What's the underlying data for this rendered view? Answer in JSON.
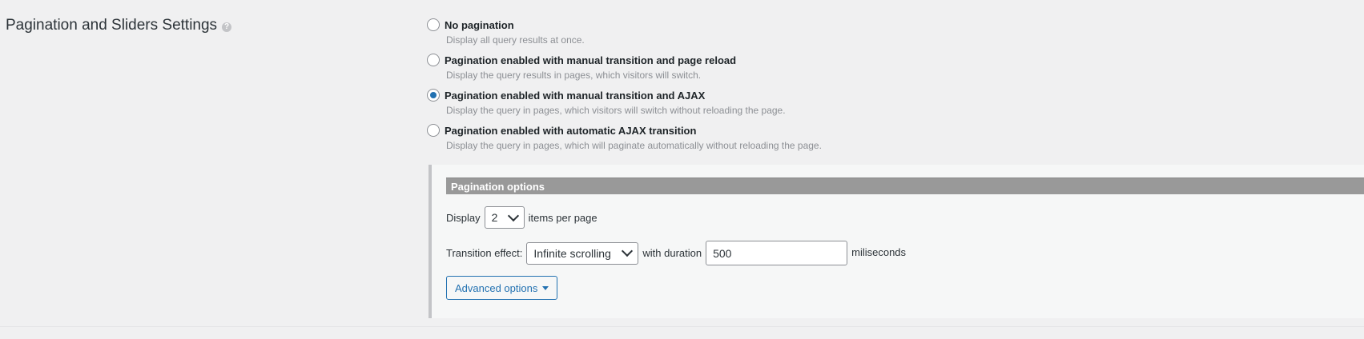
{
  "section": {
    "title": "Pagination and Sliders Settings"
  },
  "pagination_modes": [
    {
      "label": "No pagination",
      "description": "Display all query results at once.",
      "checked": false
    },
    {
      "label": "Pagination enabled with manual transition and page reload",
      "description": "Display the query results in pages, which visitors will switch.",
      "checked": false
    },
    {
      "label": "Pagination enabled with manual transition and AJAX",
      "description": "Display the query in pages, which visitors will switch without reloading the page.",
      "checked": true
    },
    {
      "label": "Pagination enabled with automatic AJAX transition",
      "description": "Display the query in pages, which will paginate automatically without reloading the page.",
      "checked": false
    }
  ],
  "pagination_options": {
    "header": "Pagination options",
    "display_label": "Display",
    "items_per_page_value": "2",
    "items_per_page_suffix": "items per page",
    "transition_label": "Transition effect:",
    "transition_value": "Infinite scrolling",
    "duration_label": "with duration",
    "duration_value": "500",
    "duration_unit": "miliseconds",
    "advanced_button": "Advanced options"
  },
  "colors": {
    "accent": "#2271b1",
    "header_bg": "#999999",
    "page_bg": "#f0f0f1"
  }
}
